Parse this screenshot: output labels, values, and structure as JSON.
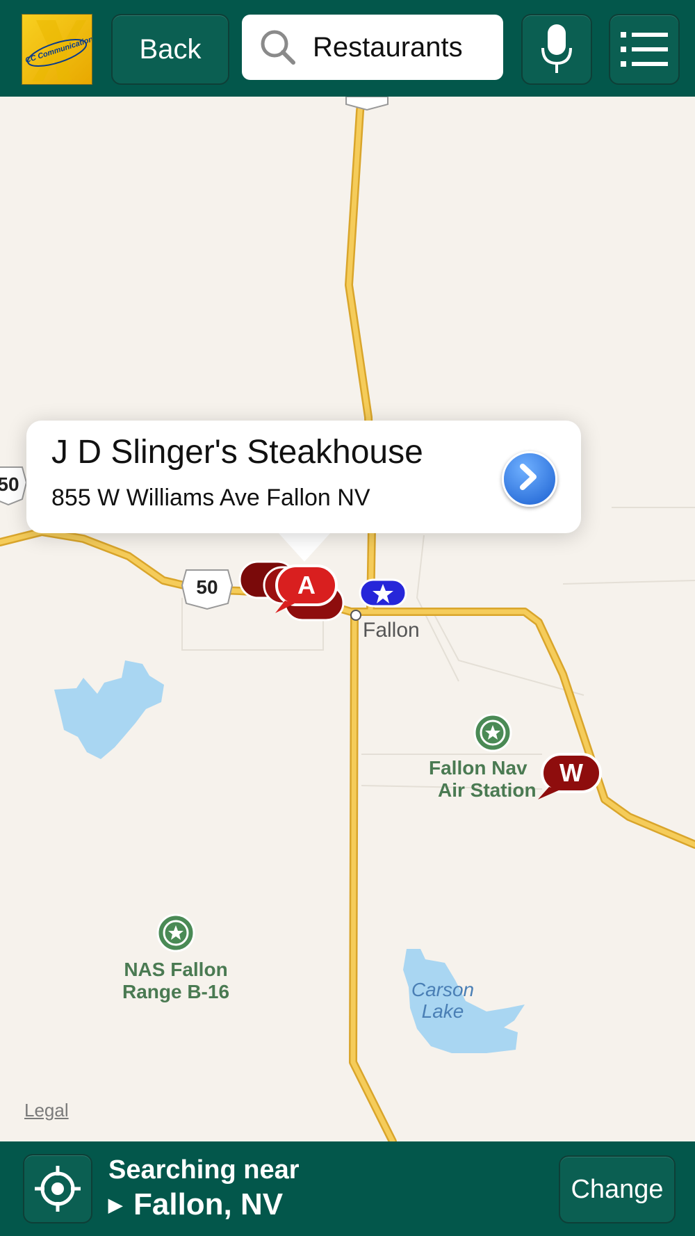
{
  "header": {
    "logo_text": "CC Communications",
    "back_label": "Back",
    "search_value": "Restaurants",
    "colors": {
      "bar": "#03574b",
      "button": "#0b5f52"
    }
  },
  "map": {
    "callout": {
      "title": "J D Slinger's Steakhouse",
      "address": "855 W Williams Ave Fallon NV"
    },
    "pins": [
      "A",
      "W",
      "B"
    ],
    "route_shields": [
      "50",
      "50",
      "95"
    ],
    "places": {
      "city": "Fallon",
      "naval_station_line1": "Fallon Nav",
      "naval_station_line2": "Air Station",
      "range_line1": "NAS Fallon",
      "range_line2": "Range B-16",
      "lake_line1": "Carson",
      "lake_line2": "Lake"
    },
    "legal_label": "Legal",
    "colors": {
      "land": "#f6f2ec",
      "road": "#f3c04a",
      "water": "#a9d6f2",
      "pin": "#8e0d0d",
      "pin_active": "#d91f1f",
      "park": "#4a8a55"
    }
  },
  "footer": {
    "searching_near_label": "Searching near",
    "location": "Fallon, NV",
    "change_label": "Change"
  }
}
